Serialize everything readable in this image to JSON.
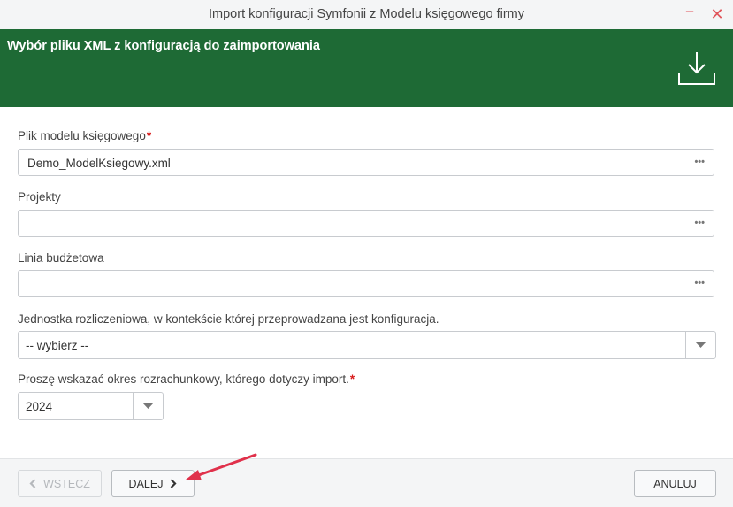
{
  "window": {
    "title": "Import konfiguracji Symfonii z Modelu księgowego firmy"
  },
  "header": {
    "heading": "Wybór pliku XML z konfiguracją do zaimportowania",
    "icon": "download-icon",
    "color": "#1e6a35"
  },
  "form": {
    "model_file": {
      "label": "Plik modelu księgowego",
      "required_mark": "*",
      "value": "Demo_ModelKsiegowy.xml",
      "browse": "•••"
    },
    "projects": {
      "label": "Projekty",
      "value": "",
      "browse": "•••"
    },
    "budget_line": {
      "label": "Linia budżetowa",
      "value": "",
      "browse": "•••"
    },
    "unit": {
      "label": "Jednostka rozliczeniowa, w kontekście której przeprowadzana jest konfiguracja.",
      "value": "-- wybierz --"
    },
    "period": {
      "label": "Proszę wskazać okres rozrachunkowy, którego dotyczy import.",
      "required_mark": "*",
      "value": "2024"
    }
  },
  "footer": {
    "back_label": "WSTECZ",
    "next_label": "DALEJ",
    "cancel_label": "ANULUJ"
  },
  "colors": {
    "accent": "#1e6a35",
    "required": "#d81b1b",
    "annotation_arrow": "#e0314b"
  }
}
